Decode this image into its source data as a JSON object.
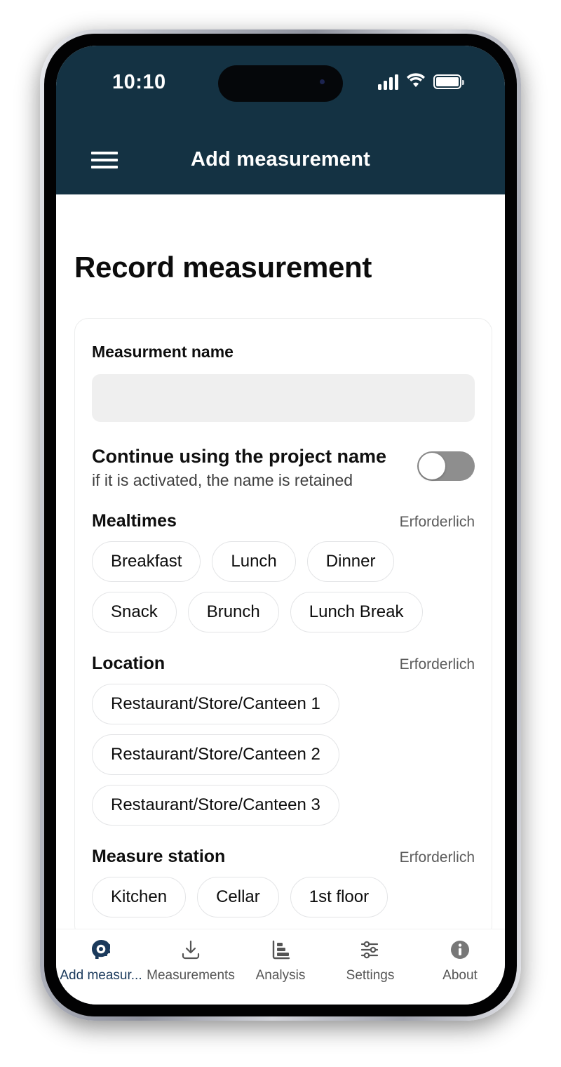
{
  "status_bar": {
    "time": "10:10",
    "signal_icon": "cellular-signal-icon",
    "wifi_icon": "wifi-icon",
    "battery_icon": "battery-icon"
  },
  "app_bar": {
    "menu_icon": "hamburger-menu-icon",
    "title": "Add measurement"
  },
  "page": {
    "title": "Record measurement"
  },
  "form": {
    "name_label": "Measurment name",
    "name_value": "",
    "name_placeholder": "",
    "toggle": {
      "title": "Continue using the project name",
      "subtitle": "if it is activated, the name is retained",
      "state": "off"
    }
  },
  "sections": [
    {
      "title": "Mealtimes",
      "required_label": "Erforderlich",
      "layout": "inline",
      "options": [
        "Breakfast",
        "Lunch",
        "Dinner",
        "Snack",
        "Brunch",
        "Lunch Break"
      ]
    },
    {
      "title": "Location",
      "required_label": "Erforderlich",
      "layout": "stacked",
      "options": [
        "Restaurant/Store/Canteen 1",
        "Restaurant/Store/Canteen 2",
        "Restaurant/Store/Canteen 3"
      ]
    },
    {
      "title": "Measure station",
      "required_label": "Erforderlich",
      "layout": "inline",
      "options": [
        "Kitchen",
        "Cellar",
        "1st floor"
      ]
    }
  ],
  "bottom_nav": {
    "items": [
      {
        "label": "Add measur...",
        "icon": "measure-tape-icon",
        "active": true
      },
      {
        "label": "Measurements",
        "icon": "download-icon",
        "active": false
      },
      {
        "label": "Analysis",
        "icon": "bar-chart-icon",
        "active": false
      },
      {
        "label": "Settings",
        "icon": "sliders-icon",
        "active": false
      },
      {
        "label": "About",
        "icon": "info-circle-icon",
        "active": false
      }
    ]
  },
  "colors": {
    "header_bg": "#143243",
    "accent": "#1b3a5c",
    "input_bg": "#efefef",
    "toggle_off": "#8e8e8e",
    "chip_border": "#e3e4e6"
  }
}
